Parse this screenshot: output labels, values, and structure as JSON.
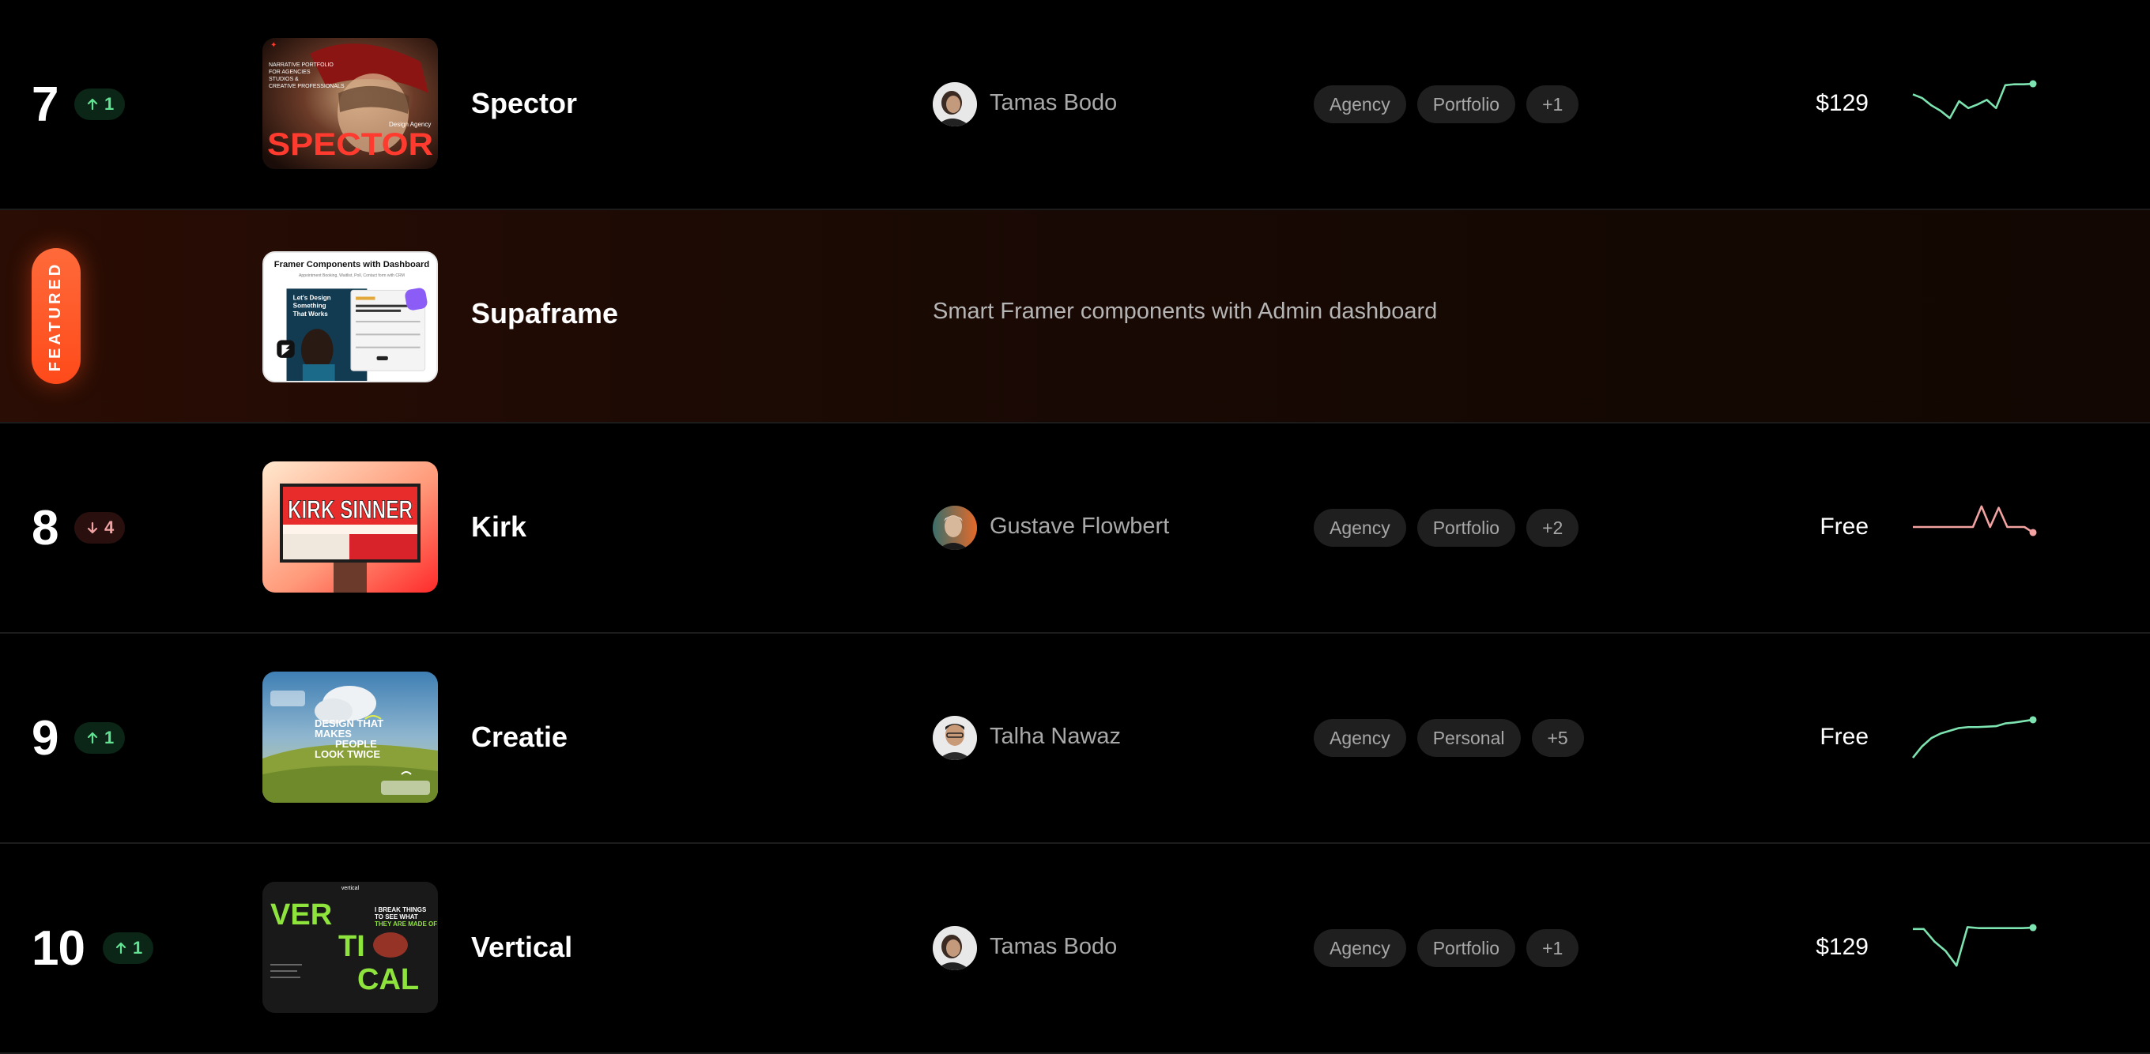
{
  "rows": [
    {
      "rank": "7",
      "trend": "up",
      "delta": "1",
      "name": "Spector",
      "creator": "Tamas Bodo",
      "tags": [
        "Agency",
        "Portfolio",
        "+1"
      ],
      "price": "$129",
      "spark_color": "#7de3b0",
      "spark": [
        0.7,
        0.62,
        0.46,
        0.34,
        0.18,
        0.55,
        0.4,
        0.48,
        0.58,
        0.4,
        0.9,
        0.92,
        0.92,
        0.93
      ],
      "thumb": {
        "small_text": [
          "NARRATIVE PORTFOLIO",
          "FOR AGENCIES",
          "STUDIOS &",
          "CREATIVE PROFESSIONALS"
        ],
        "word": "SPECTOR",
        "caption": "Design Agency"
      }
    },
    {
      "badge": "FEATURED",
      "name": "Supaframe",
      "description": "Smart Framer components with Admin dashboard",
      "thumb": {
        "title": "Framer Components with Dashboard",
        "subtitle": "Appointment Booking, Waitlist, Poll, Contact form with CRM",
        "headline": [
          "Let's Design",
          "Something",
          "That Works"
        ]
      }
    },
    {
      "rank": "8",
      "trend": "down",
      "delta": "4",
      "name": "Kirk",
      "creator": "Gustave Flowbert",
      "tags": [
        "Agency",
        "Portfolio",
        "+2"
      ],
      "price": "Free",
      "spark_color": "#f3a2a2",
      "spark": [
        0.5,
        0.5,
        0.5,
        0.5,
        0.5,
        0.5,
        0.5,
        0.5,
        0.95,
        0.5,
        0.92,
        0.5,
        0.5,
        0.5,
        0.38
      ],
      "thumb": {
        "word": "KIRK SINNER"
      }
    },
    {
      "rank": "9",
      "trend": "up",
      "delta": "1",
      "name": "Creatie",
      "creator": "Talha Nawaz",
      "tags": [
        "Agency",
        "Personal",
        "+5"
      ],
      "price": "Free",
      "spark_color": "#7de3b0",
      "spark": [
        0.05,
        0.3,
        0.48,
        0.58,
        0.64,
        0.7,
        0.72,
        0.72,
        0.73,
        0.74,
        0.8,
        0.82,
        0.85,
        0.88
      ],
      "thumb": {
        "headline": [
          "DESIGN THAT",
          "MAKES",
          "PEOPLE",
          "LOOK TWICE"
        ]
      }
    },
    {
      "rank": "10",
      "trend": "up",
      "delta": "1",
      "name": "Vertical",
      "creator": "Tamas Bodo",
      "tags": [
        "Agency",
        "Portfolio",
        "+1"
      ],
      "price": "$129",
      "spark_color": "#7de3b0",
      "spark": [
        0.9,
        0.9,
        0.62,
        0.42,
        0.1,
        0.94,
        0.92,
        0.92,
        0.92,
        0.92,
        0.92,
        0.93
      ],
      "thumb": {
        "brand": "vertical",
        "words": [
          "VER",
          "TI",
          "CAL"
        ],
        "side": [
          "I BREAK THINGS",
          "TO SEE WHAT",
          "THEY ARE MADE OF"
        ]
      }
    }
  ],
  "colors": {
    "up_text": "#62e393",
    "down_text": "#f1a3a3",
    "accent": "#ff5a26"
  }
}
